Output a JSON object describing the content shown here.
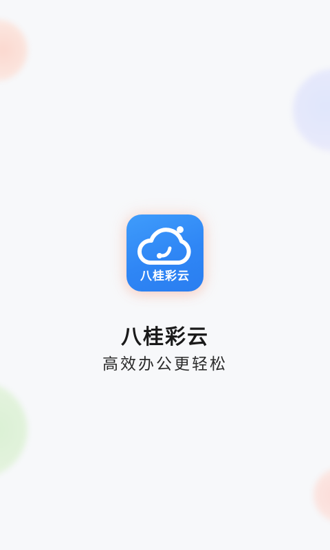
{
  "splash": {
    "icon_caption": "八桂彩云",
    "icon_name": "cloud-logo-icon",
    "app_name": "八桂彩云",
    "slogan": "高效办公更轻松"
  },
  "colors": {
    "background": "#f7f8fa",
    "icon_blue": "#2f86f5",
    "text_dark": "#1a1a1a"
  }
}
